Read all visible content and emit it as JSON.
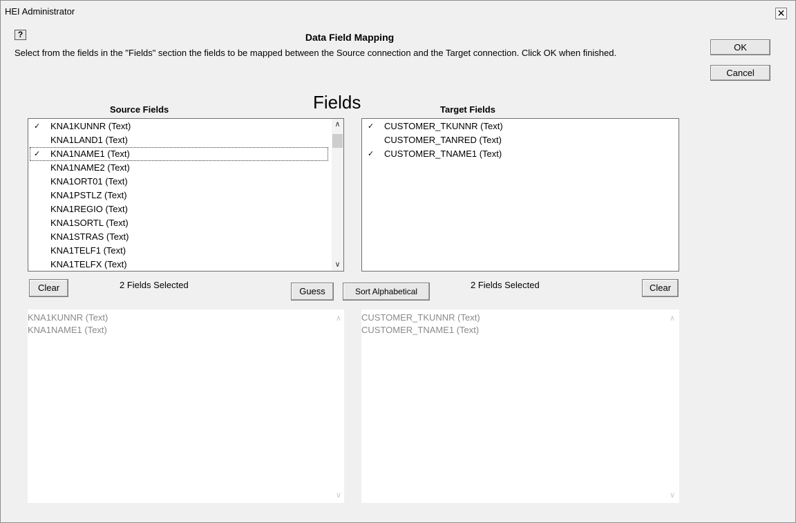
{
  "window": {
    "title": "HEI Administrator",
    "close_glyph": "✕"
  },
  "dialog": {
    "help_label": "?",
    "title": "Data Field Mapping",
    "instructions": "Select from the fields in the \"Fields\" section the fields to be mapped between the Source connection and the Target connection. Click OK when finished.",
    "ok_label": "OK",
    "cancel_label": "Cancel",
    "fields_heading": "Fields"
  },
  "source": {
    "heading": "Source Fields",
    "items": [
      {
        "label": "KNA1KUNNR (Text)",
        "check": "✓"
      },
      {
        "label": "KNA1LAND1 (Text)",
        "check": ""
      },
      {
        "label": "KNA1NAME1 (Text)",
        "check": "✓"
      },
      {
        "label": "KNA1NAME2 (Text)",
        "check": ""
      },
      {
        "label": "KNA1ORT01 (Text)",
        "check": ""
      },
      {
        "label": "KNA1PSTLZ (Text)",
        "check": ""
      },
      {
        "label": "KNA1REGIO (Text)",
        "check": ""
      },
      {
        "label": "KNA1SORTL (Text)",
        "check": ""
      },
      {
        "label": "KNA1STRAS (Text)",
        "check": ""
      },
      {
        "label": "KNA1TELF1 (Text)",
        "check": ""
      },
      {
        "label": "KNA1TELFX (Text)",
        "check": ""
      }
    ],
    "clear_label": "Clear",
    "status": "2 Fields Selected",
    "selected": [
      "KNA1KUNNR (Text)",
      "KNA1NAME1 (Text)"
    ]
  },
  "target": {
    "heading": "Target Fields",
    "items": [
      {
        "label": "CUSTOMER_TKUNNR (Text)",
        "check": "✓"
      },
      {
        "label": "CUSTOMER_TANRED (Text)",
        "check": ""
      },
      {
        "label": "CUSTOMER_TNAME1 (Text)",
        "check": "✓"
      }
    ],
    "clear_label": "Clear",
    "status": "2 Fields Selected",
    "selected": [
      "CUSTOMER_TKUNNR (Text)",
      "CUSTOMER_TNAME1 (Text)"
    ]
  },
  "toolbar": {
    "guess_label": "Guess",
    "sort_label": "Sort Alphabetical"
  },
  "icons": {
    "scroll_up": "up-arrow-icon",
    "scroll_down": "down-arrow-icon",
    "checkmark": "checkmark-icon"
  }
}
